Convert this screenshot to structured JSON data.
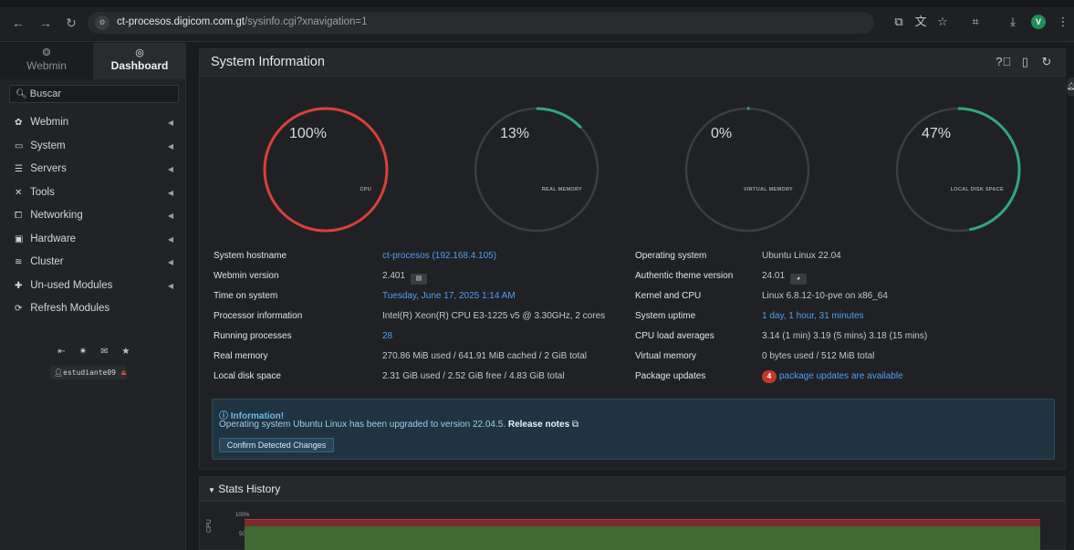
{
  "browser": {
    "url_host": "ct-procesos.digicom.com.gt",
    "url_path": "/sysinfo.cgi?xnavigation=1",
    "profile_initial": "V"
  },
  "sidebar": {
    "tabs": [
      {
        "label": "Webmin",
        "icon": "webmin-icon"
      },
      {
        "label": "Dashboard",
        "icon": "dashboard-icon"
      }
    ],
    "search_placeholder": "Buscar",
    "menu": [
      {
        "label": "Webmin",
        "icon": "gear-icon",
        "has_caret": true
      },
      {
        "label": "System",
        "icon": "monitor-icon",
        "has_caret": true
      },
      {
        "label": "Servers",
        "icon": "servers-icon",
        "has_caret": true
      },
      {
        "label": "Tools",
        "icon": "tools-icon",
        "has_caret": true
      },
      {
        "label": "Networking",
        "icon": "network-icon",
        "has_caret": true
      },
      {
        "label": "Hardware",
        "icon": "hardware-icon",
        "has_caret": true
      },
      {
        "label": "Cluster",
        "icon": "cluster-icon",
        "has_caret": true
      },
      {
        "label": "Un-used Modules",
        "icon": "puzzle-icon",
        "has_caret": true
      },
      {
        "label": "Refresh Modules",
        "icon": "refresh-icon",
        "has_caret": false
      }
    ],
    "user": "estudiante09"
  },
  "main": {
    "title": "System Information",
    "gauges": [
      {
        "value": 100,
        "label": "CPU",
        "color": "#d9403a"
      },
      {
        "value": 13,
        "label": "REAL MEMORY",
        "color": "#2ea97a"
      },
      {
        "value": 0,
        "label": "VIRTUAL MEMORY",
        "color": "#2ea97a"
      },
      {
        "value": 47,
        "label": "LOCAL DISK SPACE",
        "color": "#2ea97a"
      }
    ],
    "gauge_pct": [
      "100%",
      "13%",
      "0%",
      "47%"
    ],
    "info_left": [
      {
        "key": "System hostname",
        "value": "ct-procesos (192.168.4.105)",
        "link": true
      },
      {
        "key": "Webmin version",
        "value": "2.401",
        "link": false
      },
      {
        "key": "Time on system",
        "value": "Tuesday, June 17, 2025 1:14 AM",
        "link": true
      },
      {
        "key": "Processor information",
        "value": "Intel(R) Xeon(R) CPU E3-1225 v5 @ 3.30GHz, 2 cores",
        "link": false
      },
      {
        "key": "Running processes",
        "value": "28",
        "link": true
      },
      {
        "key": "Real memory",
        "value": "270.86 MiB used / 641.91 MiB cached / 2 GiB total",
        "link": false
      },
      {
        "key": "Local disk space",
        "value": "2.31 GiB used / 2.52 GiB free / 4.83 GiB total",
        "link": false
      }
    ],
    "info_right": [
      {
        "key": "Operating system",
        "value": "Ubuntu Linux 22.04",
        "link": false
      },
      {
        "key": "Authentic theme version",
        "value": "24.01",
        "link": false
      },
      {
        "key": "Kernel and CPU",
        "value": "Linux 6.8.12-10-pve on x86_64",
        "link": false
      },
      {
        "key": "System uptime",
        "value": "1 day, 1 hour, 31 minutes",
        "link": true
      },
      {
        "key": "CPU load averages",
        "value": "3.14 (1 min) 3.19 (5 mins) 3.18 (15 mins)",
        "link": false
      },
      {
        "key": "Virtual memory",
        "value": "0 bytes used / 512 MiB total",
        "link": false
      },
      {
        "key": "Package updates",
        "value": "package updates are available",
        "link": true,
        "badge": "4"
      }
    ],
    "alert": {
      "title": "Information!",
      "text": "Operating system Ubuntu Linux has been upgraded to version 22.04.5.",
      "link": "Release notes",
      "button": "Confirm Detected Changes"
    }
  },
  "stats": {
    "title": "Stats History",
    "y_ticks": [
      "100%",
      "50%"
    ],
    "axis_label": "CPU"
  }
}
